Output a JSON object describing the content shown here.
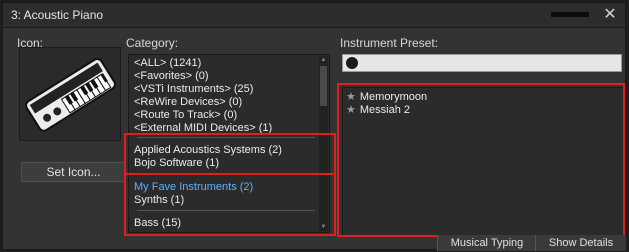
{
  "window": {
    "title": "3: Acoustic Piano"
  },
  "labels": {
    "icon": "Icon:",
    "category": "Category:",
    "preset": "Instrument Preset:"
  },
  "buttons": {
    "set_icon": "Set Icon...",
    "musical_typing": "Musical Typing",
    "show_details": "Show Details"
  },
  "search": {
    "value": "",
    "placeholder": ""
  },
  "categories": [
    {
      "label": "<ALL> (1241)"
    },
    {
      "label": "<Favorites> (0)"
    },
    {
      "label": "<VSTi Instruments> (25)"
    },
    {
      "label": "<ReWire Devices> (0)"
    },
    {
      "label": "<Route To Track> (0)"
    },
    {
      "label": "<External MIDI Devices> (1)"
    },
    {
      "label": "Applied Acoustics Systems (2)"
    },
    {
      "label": "Bojo Software (1)"
    },
    {
      "label": "My Fave Instruments (2)",
      "selected": true
    },
    {
      "label": "Synths (1)"
    },
    {
      "label": "Bass (15)"
    }
  ],
  "presets": [
    {
      "label": "Memorymoon"
    },
    {
      "label": "Messiah 2"
    }
  ],
  "colors": {
    "selected_category": "#5ab0ff",
    "highlight": "#e01e1e",
    "background": "#333333"
  }
}
